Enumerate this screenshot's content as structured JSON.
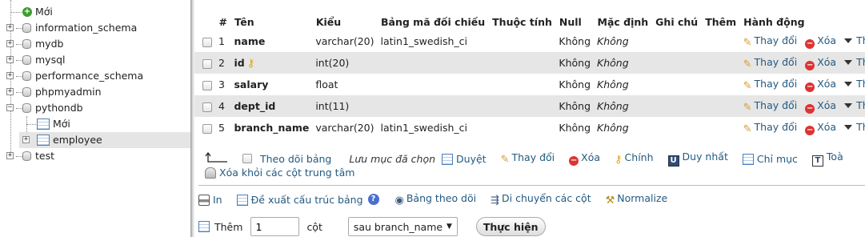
{
  "nav": {
    "items": [
      {
        "label": "Mới",
        "kind": "new"
      },
      {
        "label": "information_schema",
        "kind": "db"
      },
      {
        "label": "mydb",
        "kind": "db"
      },
      {
        "label": "mysql",
        "kind": "db"
      },
      {
        "label": "performance_schema",
        "kind": "db"
      },
      {
        "label": "phpmyadmin",
        "kind": "db"
      },
      {
        "label": "pythondb",
        "kind": "db",
        "expanded": true
      },
      {
        "label": "Mới",
        "kind": "new"
      },
      {
        "label": "employee",
        "kind": "table",
        "selected": true
      },
      {
        "label": "test",
        "kind": "db"
      }
    ]
  },
  "table": {
    "headers": [
      "#",
      "Tên",
      "Kiểu",
      "Bảng mã đối chiếu",
      "Thuộc tính",
      "Null",
      "Mặc định",
      "Ghi chú",
      "Thêm",
      "Hành động"
    ],
    "rows": [
      {
        "num": "1",
        "name": "name",
        "type": "varchar(20)",
        "collation": "latin1_swedish_ci",
        "attributes": "",
        "null": "Không",
        "default": "Không",
        "comment": "",
        "extra": "",
        "primary": false
      },
      {
        "num": "2",
        "name": "id",
        "type": "int(20)",
        "collation": "",
        "attributes": "",
        "null": "Không",
        "default": "Không",
        "comment": "",
        "extra": "",
        "primary": true
      },
      {
        "num": "3",
        "name": "salary",
        "type": "float",
        "collation": "",
        "attributes": "",
        "null": "Không",
        "default": "Không",
        "comment": "",
        "extra": "",
        "primary": false
      },
      {
        "num": "4",
        "name": "dept_id",
        "type": "int(11)",
        "collation": "",
        "attributes": "",
        "null": "Không",
        "default": "Không",
        "comment": "",
        "extra": "",
        "primary": false
      },
      {
        "num": "5",
        "name": "branch_name",
        "type": "varchar(20)",
        "collation": "latin1_swedish_ci",
        "attributes": "",
        "null": "Không",
        "default": "Không",
        "comment": "",
        "extra": "",
        "primary": false
      }
    ],
    "actions": {
      "change": "Thay đổi",
      "drop": "Xóa",
      "more": "Thêm"
    }
  },
  "bulk": {
    "check_all": "Theo dõi bảng",
    "with_selected": "Lưu mục đã chọn",
    "browse": "Duyệt",
    "change": "Thay đổi",
    "drop": "Xóa",
    "primary": "Chính",
    "unique": "Duy nhất",
    "index": "Chỉ mục",
    "fulltext": "Toà",
    "remove_central": "Xóa khỏi các cột trung tâm"
  },
  "tools": {
    "print": "In",
    "propose": "Đề xuất cấu trúc bảng",
    "track": "Bảng theo dõi",
    "move": "Di chuyển các cột",
    "normalize": "Normalize"
  },
  "add": {
    "label": "Thêm",
    "count": "1",
    "unit": "cột",
    "position": "sau branch_name",
    "go": "Thực hiện"
  },
  "colors": {
    "link": "#235a81",
    "row_alt": "#e6e6e6",
    "drop": "#dd3333",
    "key": "#d9a21b"
  }
}
